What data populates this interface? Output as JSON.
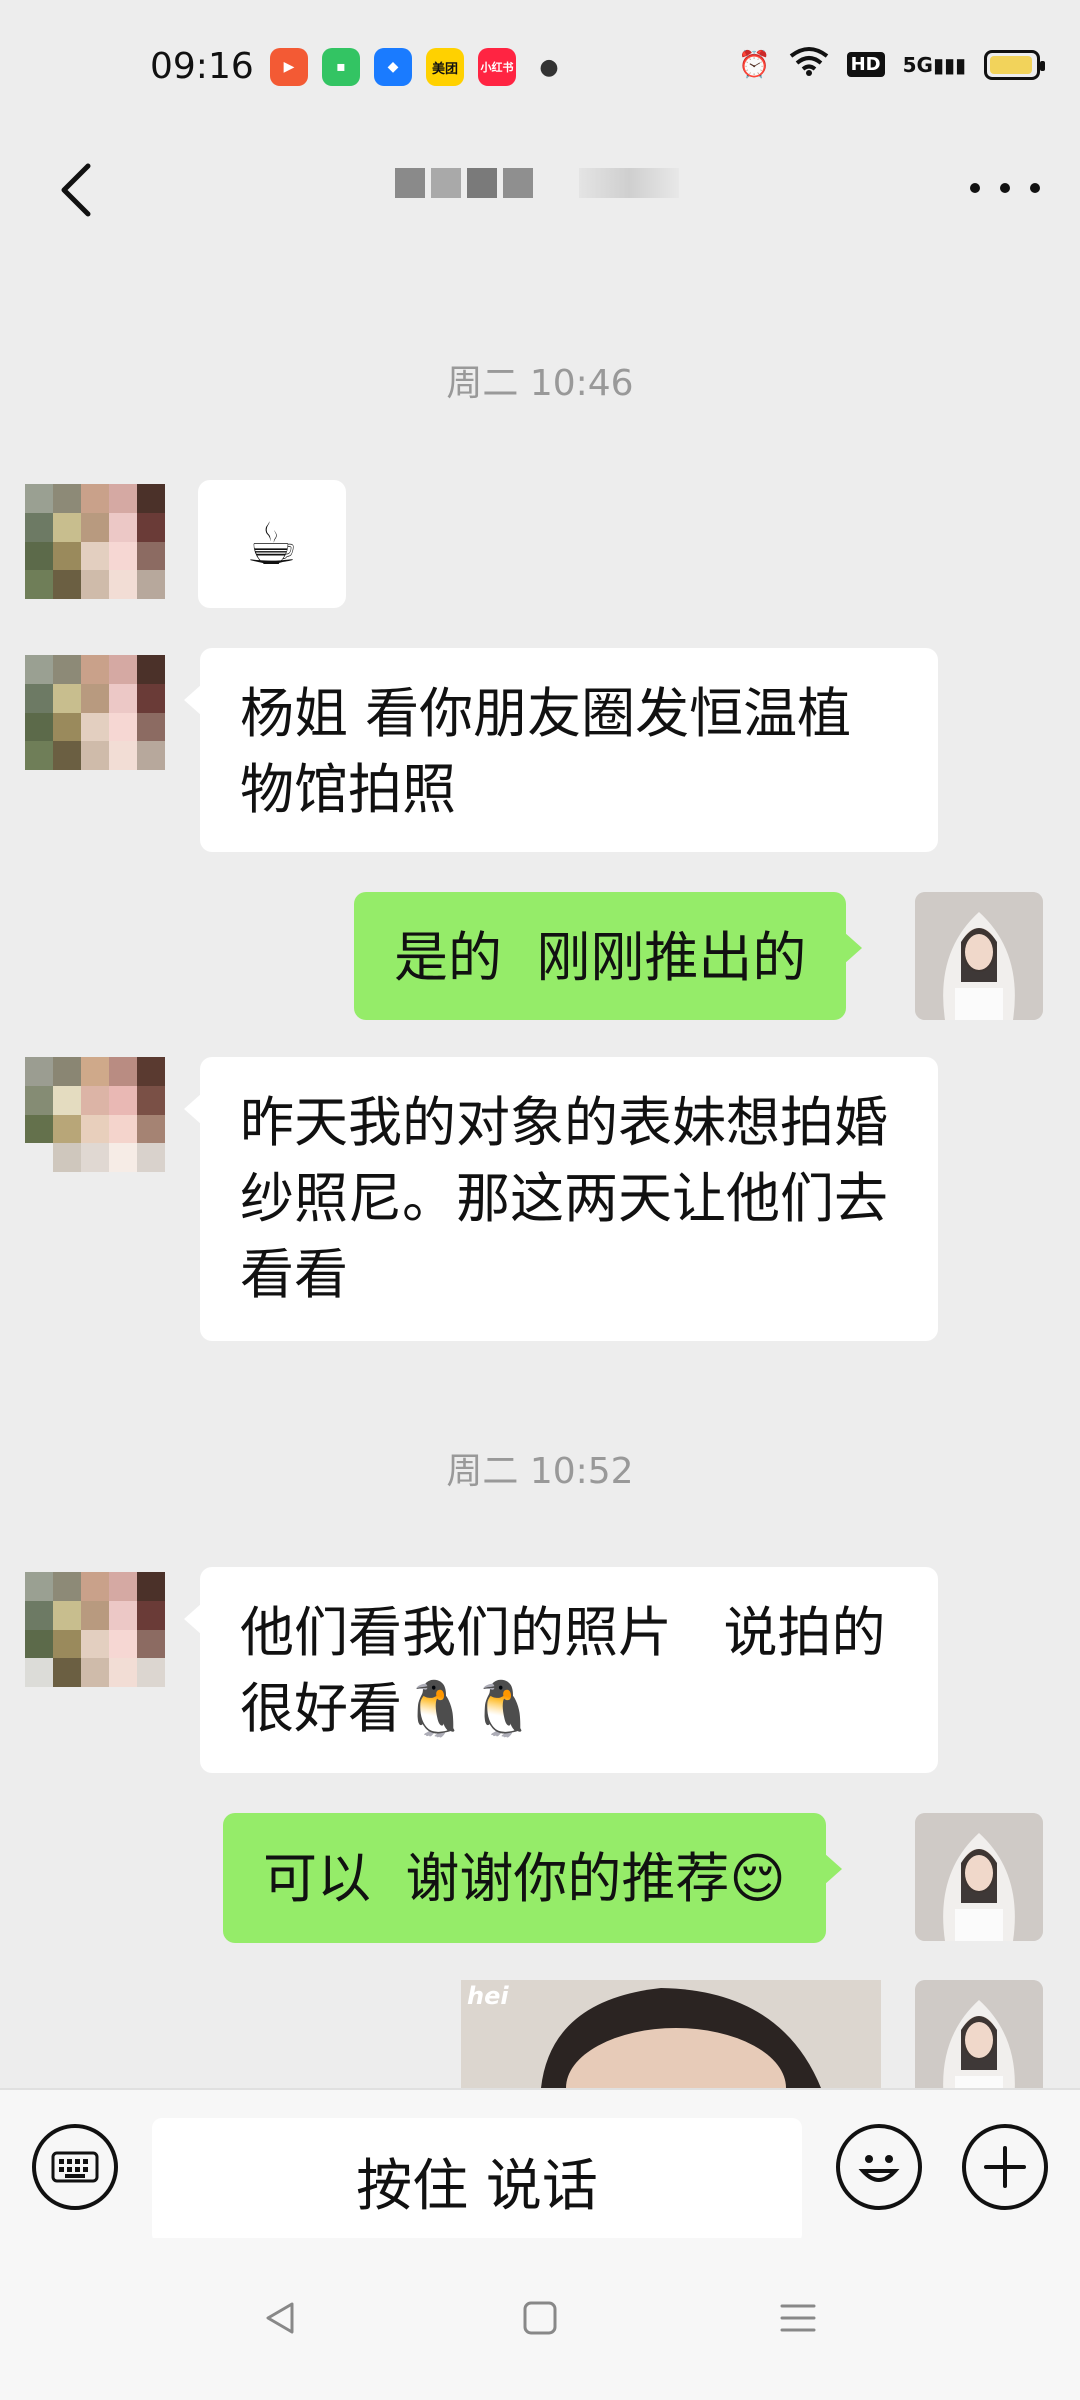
{
  "status_bar": {
    "time": "09:16",
    "apps": [
      {
        "icon": "video-app-icon",
        "color": "#f35a34",
        "label": ""
      },
      {
        "icon": "chat-app-icon",
        "color": "#33c463",
        "label": ""
      },
      {
        "icon": "browser-app-icon",
        "color": "#1a7bff",
        "label": ""
      },
      {
        "icon": "meituan-app-icon",
        "color": "#ffd100",
        "label": "美团"
      },
      {
        "icon": "xiaohongshu-app-icon",
        "color": "#ff2442",
        "label": "小红书"
      }
    ],
    "network_label": "HD",
    "signal_label": "5G",
    "battery_level": 0.95
  },
  "navbar": {
    "title": ""
  },
  "chat": {
    "timestamp_1": "周二 10:46",
    "cup_emoji": "☕",
    "msg_1": "杨姐 看你朋友圈发恒温植物馆拍照",
    "msg_2": "是的  刚刚推出的",
    "msg_3": "昨天我的对象的表妹想拍婚纱照尼。那这两天让他们去看看",
    "timestamp_2": "周二 10:52",
    "msg_4": "他们看我们的照片   说拍的很好看🐧🐧",
    "msg_5": "可以  谢谢你的推荐😌",
    "photo_caption": "hei"
  },
  "input_bar": {
    "voice_label": "按住 说话"
  },
  "colors": {
    "background": "#ededed",
    "right_bubble": "#95ec69",
    "left_bubble": "#ffffff"
  }
}
